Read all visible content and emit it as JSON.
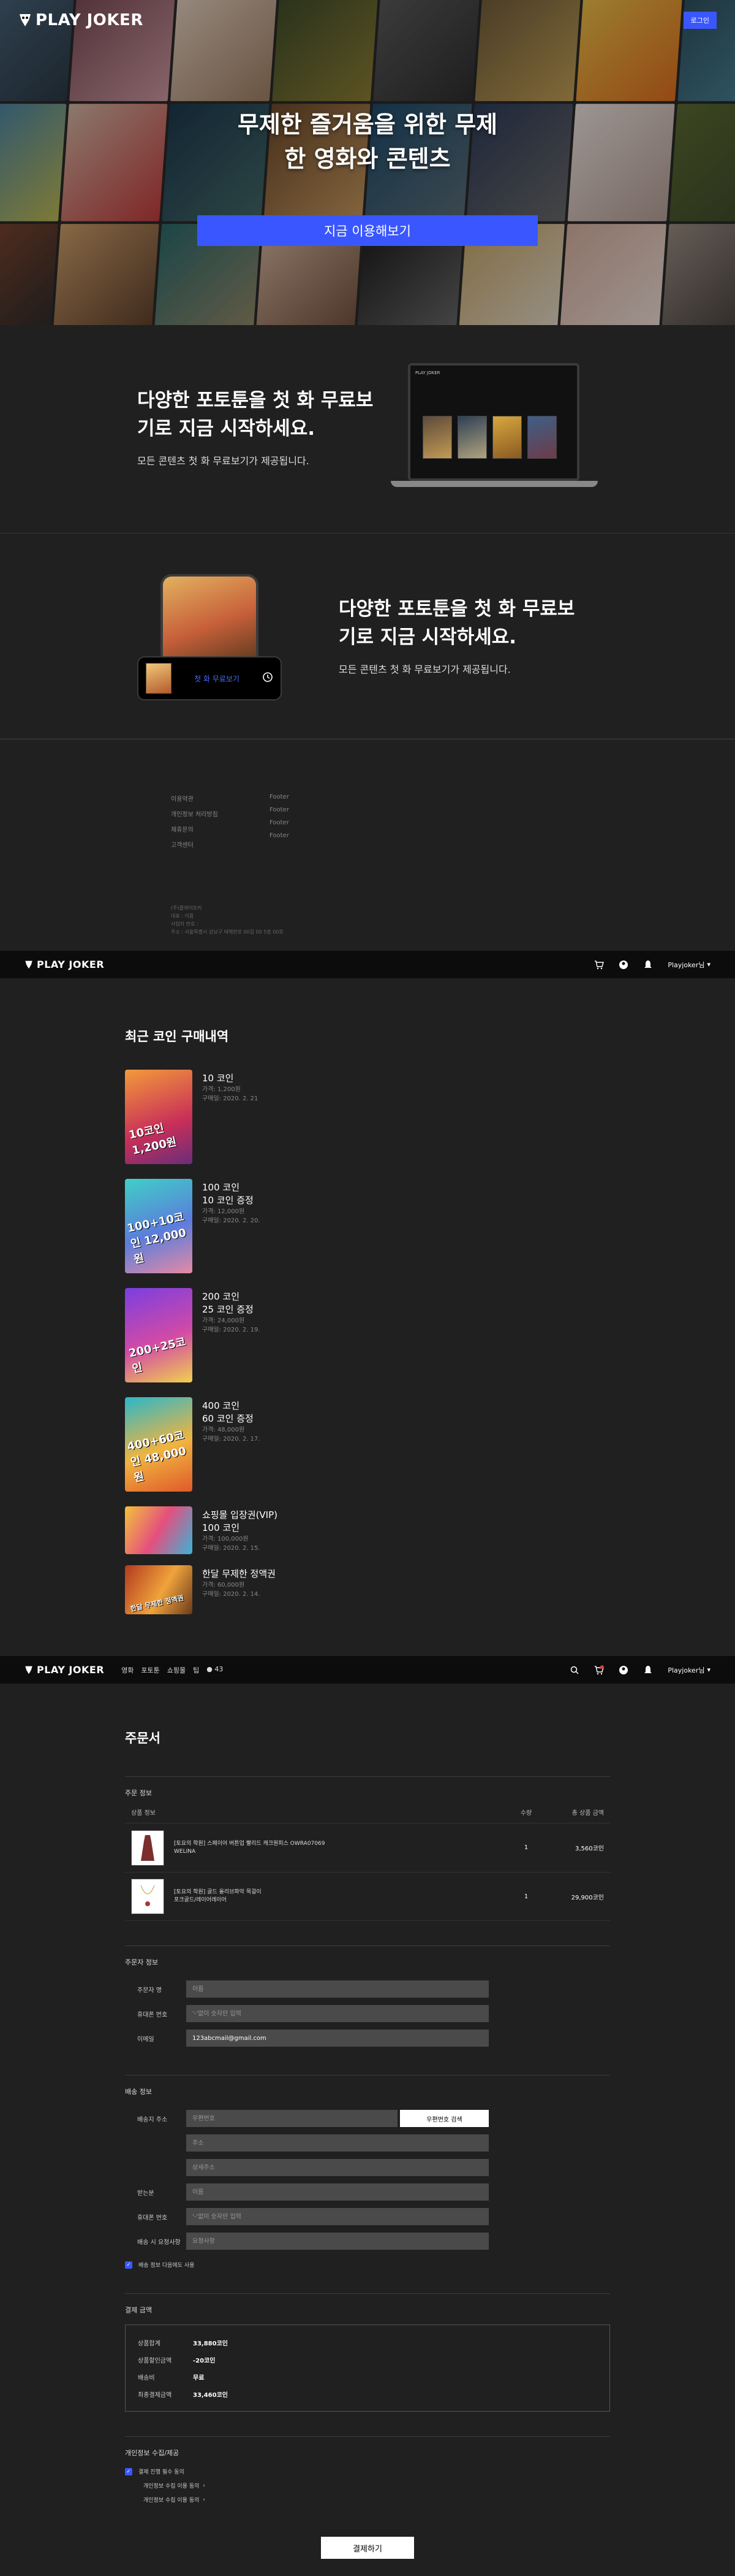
{
  "brand": {
    "name": "PLAY JOKER"
  },
  "hero": {
    "login": "로그인",
    "headline_1": "무제한 즐거움을 위한 무제",
    "headline_2": "한 영화와 콘텐츠",
    "cta": "지금 이용해보기"
  },
  "feature1": {
    "title_1": "다양한 포토툰을 첫 화 무료보",
    "title_2": "기로 지금 시작하세요.",
    "desc": "모든 콘텐츠 첫 화 무료보기가 제공됩니다."
  },
  "feature2": {
    "title_1": "다양한 포토툰을 첫 화 무료보",
    "title_2": "기로 지금 시작하세요.",
    "desc": "모든 콘텐츠 첫 화 무료보기가 제공됩니다.",
    "play_label": "첫 화 무료보기"
  },
  "footer": {
    "col1": [
      "이용약관",
      "개인정보 처리방침",
      "제휴문의",
      "고객센터"
    ],
    "col2": [
      "Footer",
      "Footer",
      "Footer",
      "Footer"
    ],
    "info": [
      "(주)플레이조커",
      "대표 : 이름",
      "사업자 번호 :",
      "주소 : 서울특별시 강남구 테헤란로 00길 00 5층 00호"
    ]
  },
  "app_header": {
    "user": "Playjoker님"
  },
  "history": {
    "title": "최근 코인 구매내역",
    "items": [
      {
        "lines": [
          "10 코인"
        ],
        "price": "가격: 1,200원",
        "date": "구매일: 2020. 2. 21",
        "badge": "10코인 1,200원"
      },
      {
        "lines": [
          "100 코인",
          "10 코인 증정"
        ],
        "price": "가격: 12,000원",
        "date": "구매일: 2020. 2. 20.",
        "badge": "100+10코인 12,000원"
      },
      {
        "lines": [
          "200 코인",
          "25 코인 증정"
        ],
        "price": "가격: 24,000원",
        "date": "구매일: 2020. 2. 19.",
        "badge": "200+25코인"
      },
      {
        "lines": [
          "400 코인",
          "60 코인 증정"
        ],
        "price": "가격: 48,000원",
        "date": "구매일: 2020. 2. 17.",
        "badge": "400+60코인 48,000원"
      },
      {
        "lines": [
          "쇼핑몰 입장권(VIP)",
          "100 코인"
        ],
        "price": "가격: 100,000원",
        "date": "구매일: 2020. 2. 15.",
        "badge": ""
      },
      {
        "lines": [
          "한달 무제한 정액권"
        ],
        "price": "가격: 60,000원",
        "date": "구매일: 2020. 2. 14.",
        "badge": "한달 무제한 정액권"
      }
    ]
  },
  "order_nav": [
    "영화",
    "포토툰",
    "쇼핑몰",
    "팁"
  ],
  "order_coin": "43",
  "order": {
    "title": "주문서",
    "product_section": "주문 정보",
    "col_product": "상품 정보",
    "col_qty": "수량",
    "col_total": "총 상품 금액",
    "products": [
      {
        "name_1": "[토요의 학원] 스페이어 버튼업 빨리드 캐크원피스 OWRA07069",
        "name_2": "WELINA",
        "qty": "1",
        "price": "3,560코인"
      },
      {
        "name_1": "[토요의 학원] 골드 올리브파악 목걸이",
        "name_2": "포크골드/레이어레이어",
        "qty": "1",
        "price": "29,900코인"
      }
    ],
    "buyer_section": "주문자 정보",
    "buyer": [
      {
        "label": "주문자 명",
        "placeholder": "이름",
        "value": ""
      },
      {
        "label": "휴대폰 번호",
        "placeholder": "'-'없이 숫자만 입력",
        "value": ""
      },
      {
        "label": "이메일",
        "placeholder": "",
        "value": "123abcmail@gmail.com"
      }
    ],
    "ship_section": "배송 정보",
    "ship_addr_label": "배송지 주소",
    "ship_zip_ph": "우편번호",
    "ship_find": "우편번호 검색",
    "ship_addr_ph": "주소",
    "ship_detail_ph": "상세주소",
    "ship": [
      {
        "label": "받는분",
        "placeholder": "이름"
      },
      {
        "label": "휴대폰 번호",
        "placeholder": "'-'없이 숫자만 입력"
      },
      {
        "label": "배송 시 요청사항",
        "placeholder": "요청사항"
      }
    ],
    "ship_same": "배송 정보 다음에도 사용",
    "pay_section": "결제 금액",
    "pay": [
      {
        "k": "상품합계",
        "v": "33,880코인"
      },
      {
        "k": "상품할인금액",
        "v": "-20코인"
      },
      {
        "k": "배송비",
        "v": "무료"
      },
      {
        "k": "최종결제금액",
        "v": "33,460코인"
      }
    ],
    "terms_section": "개인정보 수집/제공",
    "terms_all": "결제 진행 필수 동의",
    "terms": [
      "개인정보 수집 이용 동의 ",
      "개인정보 수집 이용 동의 "
    ],
    "submit": "결제하기"
  },
  "colors": {
    "accent": "#3a57ff",
    "bg": "#202020"
  }
}
